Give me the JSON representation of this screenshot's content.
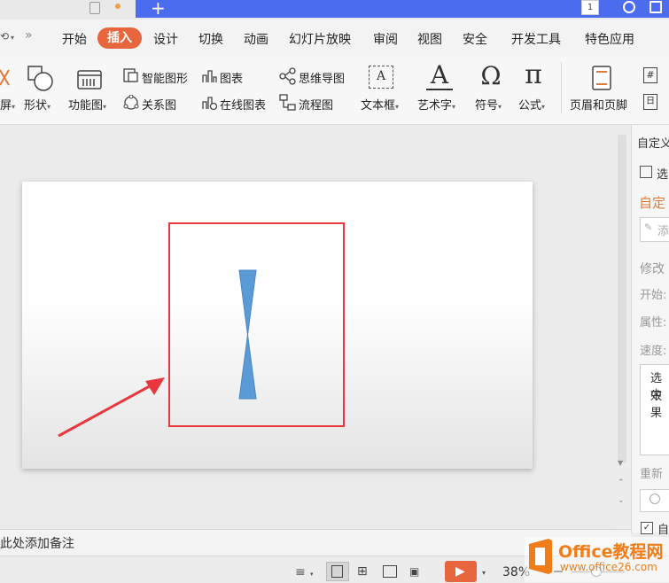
{
  "menu": {
    "items": [
      "开始",
      "插入",
      "设计",
      "切换",
      "动画",
      "幻灯片放映",
      "审阅",
      "视图",
      "安全",
      "开发工具",
      "特色应用"
    ],
    "active_color": "#e8663d"
  },
  "ribbon": {
    "partial_left_label": "屏",
    "shape_label": "形状",
    "function_chart_label": "功能图",
    "smart_shape_label": "智能图形",
    "chart_label": "图表",
    "mindmap_label": "思维导图",
    "relation_label": "关系图",
    "online_chart_label": "在线图表",
    "flowchart_label": "流程图",
    "textbox_label": "文本框",
    "wordart_label": "艺术字",
    "symbol_label": "符号",
    "formula_label": "公式",
    "header_footer_label": "页眉和页脚",
    "textbox_glyph": "A",
    "wordart_glyph": "A",
    "symbol_glyph": "Ω",
    "formula_glyph": "π",
    "partial_right_a": "#",
    "partial_right_b": "日"
  },
  "title_strip": {
    "page_number": "1",
    "tab_plus": "+"
  },
  "right_pane": {
    "header": "自定义",
    "select_label": "选",
    "section_title": "自定",
    "add_effect": "添",
    "modify": "修改",
    "start": "开始:",
    "property": "属性:",
    "speed": "速度:",
    "hint_line1": "选中",
    "hint_line2": "效果",
    "reorder": "重新",
    "autopreview": "自"
  },
  "notes": {
    "placeholder": "此处添加备注"
  },
  "status": {
    "zoom": "38%"
  },
  "watermark": {
    "brand": "Office教程网",
    "url": "www.office26.com"
  },
  "colors": {
    "shape_blue": "#5b9bd5",
    "highlight_red": "#e8383d",
    "brand_orange": "#f07d18"
  }
}
